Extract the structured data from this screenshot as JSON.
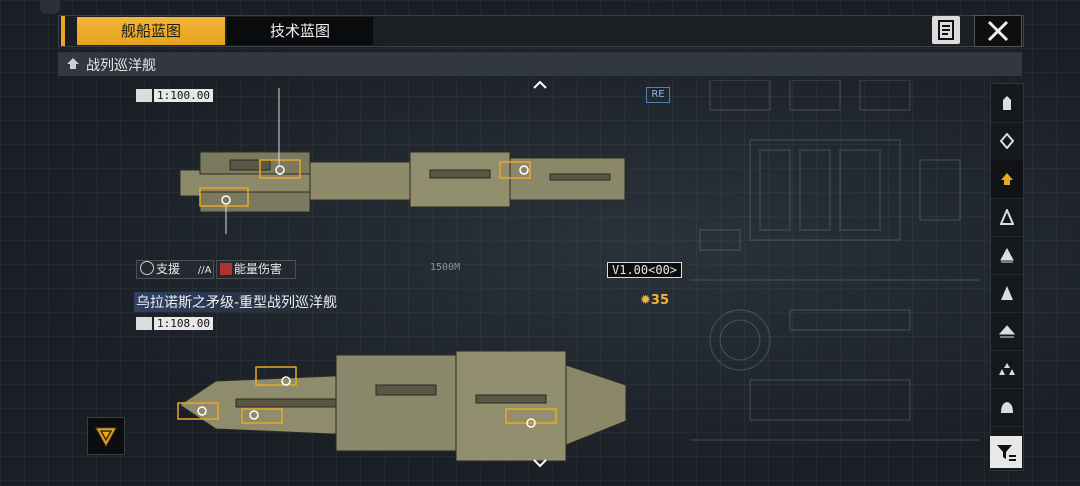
{
  "tabs": [
    {
      "label": "舰船蓝图",
      "active": true
    },
    {
      "label": "技术蓝图",
      "active": false
    }
  ],
  "section": {
    "label": "战列巡洋舰"
  },
  "ship1": {
    "scale": "1:100.00",
    "role_tag": "支援",
    "role_suffix": "//A",
    "damage_tag": "能量伤害",
    "version": "V1.00<00>",
    "badge": "RE",
    "scale_label": "1500M"
  },
  "ship2": {
    "name": "乌拉诺斯之矛级-重型战列巡洋舰",
    "scale": "1:108.00",
    "count": "35"
  },
  "sidebar": {
    "icons": [
      "frigate-icon",
      "destroyer-icon",
      "battlecruiser-icon",
      "cruiser-icon",
      "carrier-icon",
      "battleship-icon",
      "corvette-icon",
      "fighter-icon",
      "station-icon"
    ],
    "selected_index": 2
  },
  "colors": {
    "accent": "#e9a824",
    "bg": "#1c2127"
  }
}
